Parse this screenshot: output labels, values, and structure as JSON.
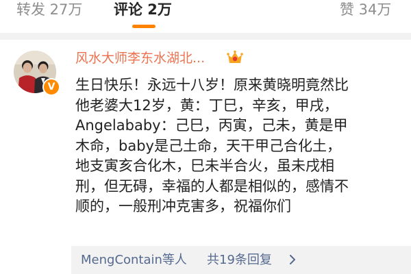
{
  "tabs": {
    "repost": "转发 27万",
    "comments": "评论 2万",
    "likes": "赞 34万"
  },
  "comment": {
    "username": "风水大师李东水湖北...",
    "text": "生日快乐！永远十八岁！原来黄晓明竟然比\n他老婆大12岁，黄：丁巳，辛亥，甲戌，\nAngelababy：己巳，丙寅，己未，黄是甲\n木命，baby是己土命，天干甲己合化土，\n地支寅亥合化木，巳未半合火，虽未戌相\n刑，但无碍，幸福的人都是相似的，感情不\n顺的，一般刑冲克害多，祝福你们",
    "verify_symbol": "V",
    "replies": {
      "users": "MengContain等人",
      "count": "共19条回复"
    }
  },
  "icons": {
    "avatar": "avatar-photo",
    "verified": "verified-badge-icon",
    "user_badge": "vip-badge-icon",
    "chevron": "chevron-right-icon"
  },
  "colors": {
    "accent": "#ff8200",
    "username": "#eb7350",
    "link": "#55698f",
    "muted": "#8d8d8d"
  }
}
